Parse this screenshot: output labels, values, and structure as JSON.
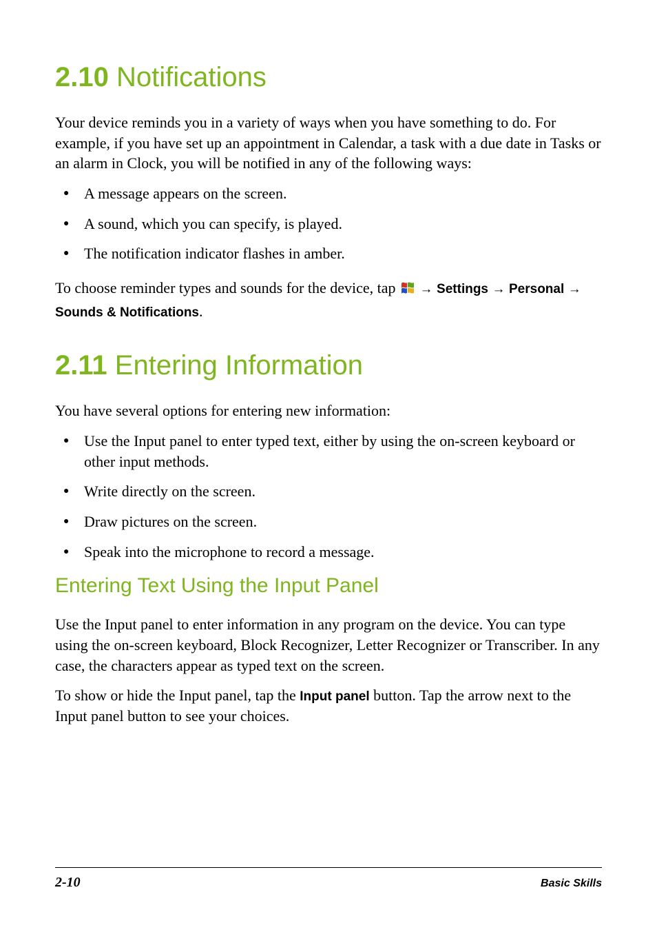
{
  "section210": {
    "number": "2.10",
    "title": "Notifications",
    "intro": "Your device reminds you in a variety of ways when you have something to do. For example, if you have set up an appointment in Calendar, a task with a due date in Tasks or an alarm in Clock, you will be notified in any of the following ways:",
    "bullets": [
      "A message appears on the screen.",
      "A sound, which you can specify, is played.",
      "The notification indicator flashes in amber."
    ],
    "navPath": {
      "prefix": "To choose reminder types and sounds for the device, tap ",
      "arrow": "→",
      "settings": "Settings",
      "personal": "Personal",
      "sounds": "Sounds & Notifications",
      "period": "."
    }
  },
  "section211": {
    "number": "2.11",
    "title": "Entering Information",
    "intro": "You have several options for entering new information:",
    "bullets": [
      "Use the Input panel to enter typed text, either by using the on-screen keyboard or other input methods.",
      "Write directly on the screen.",
      "Draw pictures on the screen.",
      "Speak into the microphone to record a message."
    ],
    "subsection": {
      "title": "Entering Text Using the Input Panel",
      "para1": "Use the Input panel to enter information in any program on the device. You can type using the on-screen keyboard, Block Recognizer, Letter Recognizer or Transcriber. In any case, the characters appear as typed text on the screen.",
      "para2_prefix": "To show or hide the Input panel, tap the ",
      "para2_bold": "Input panel",
      "para2_suffix": " button. Tap the arrow next to the Input panel button to see your choices."
    }
  },
  "footer": {
    "pageNumber": "2-10",
    "title": "Basic Skills"
  }
}
